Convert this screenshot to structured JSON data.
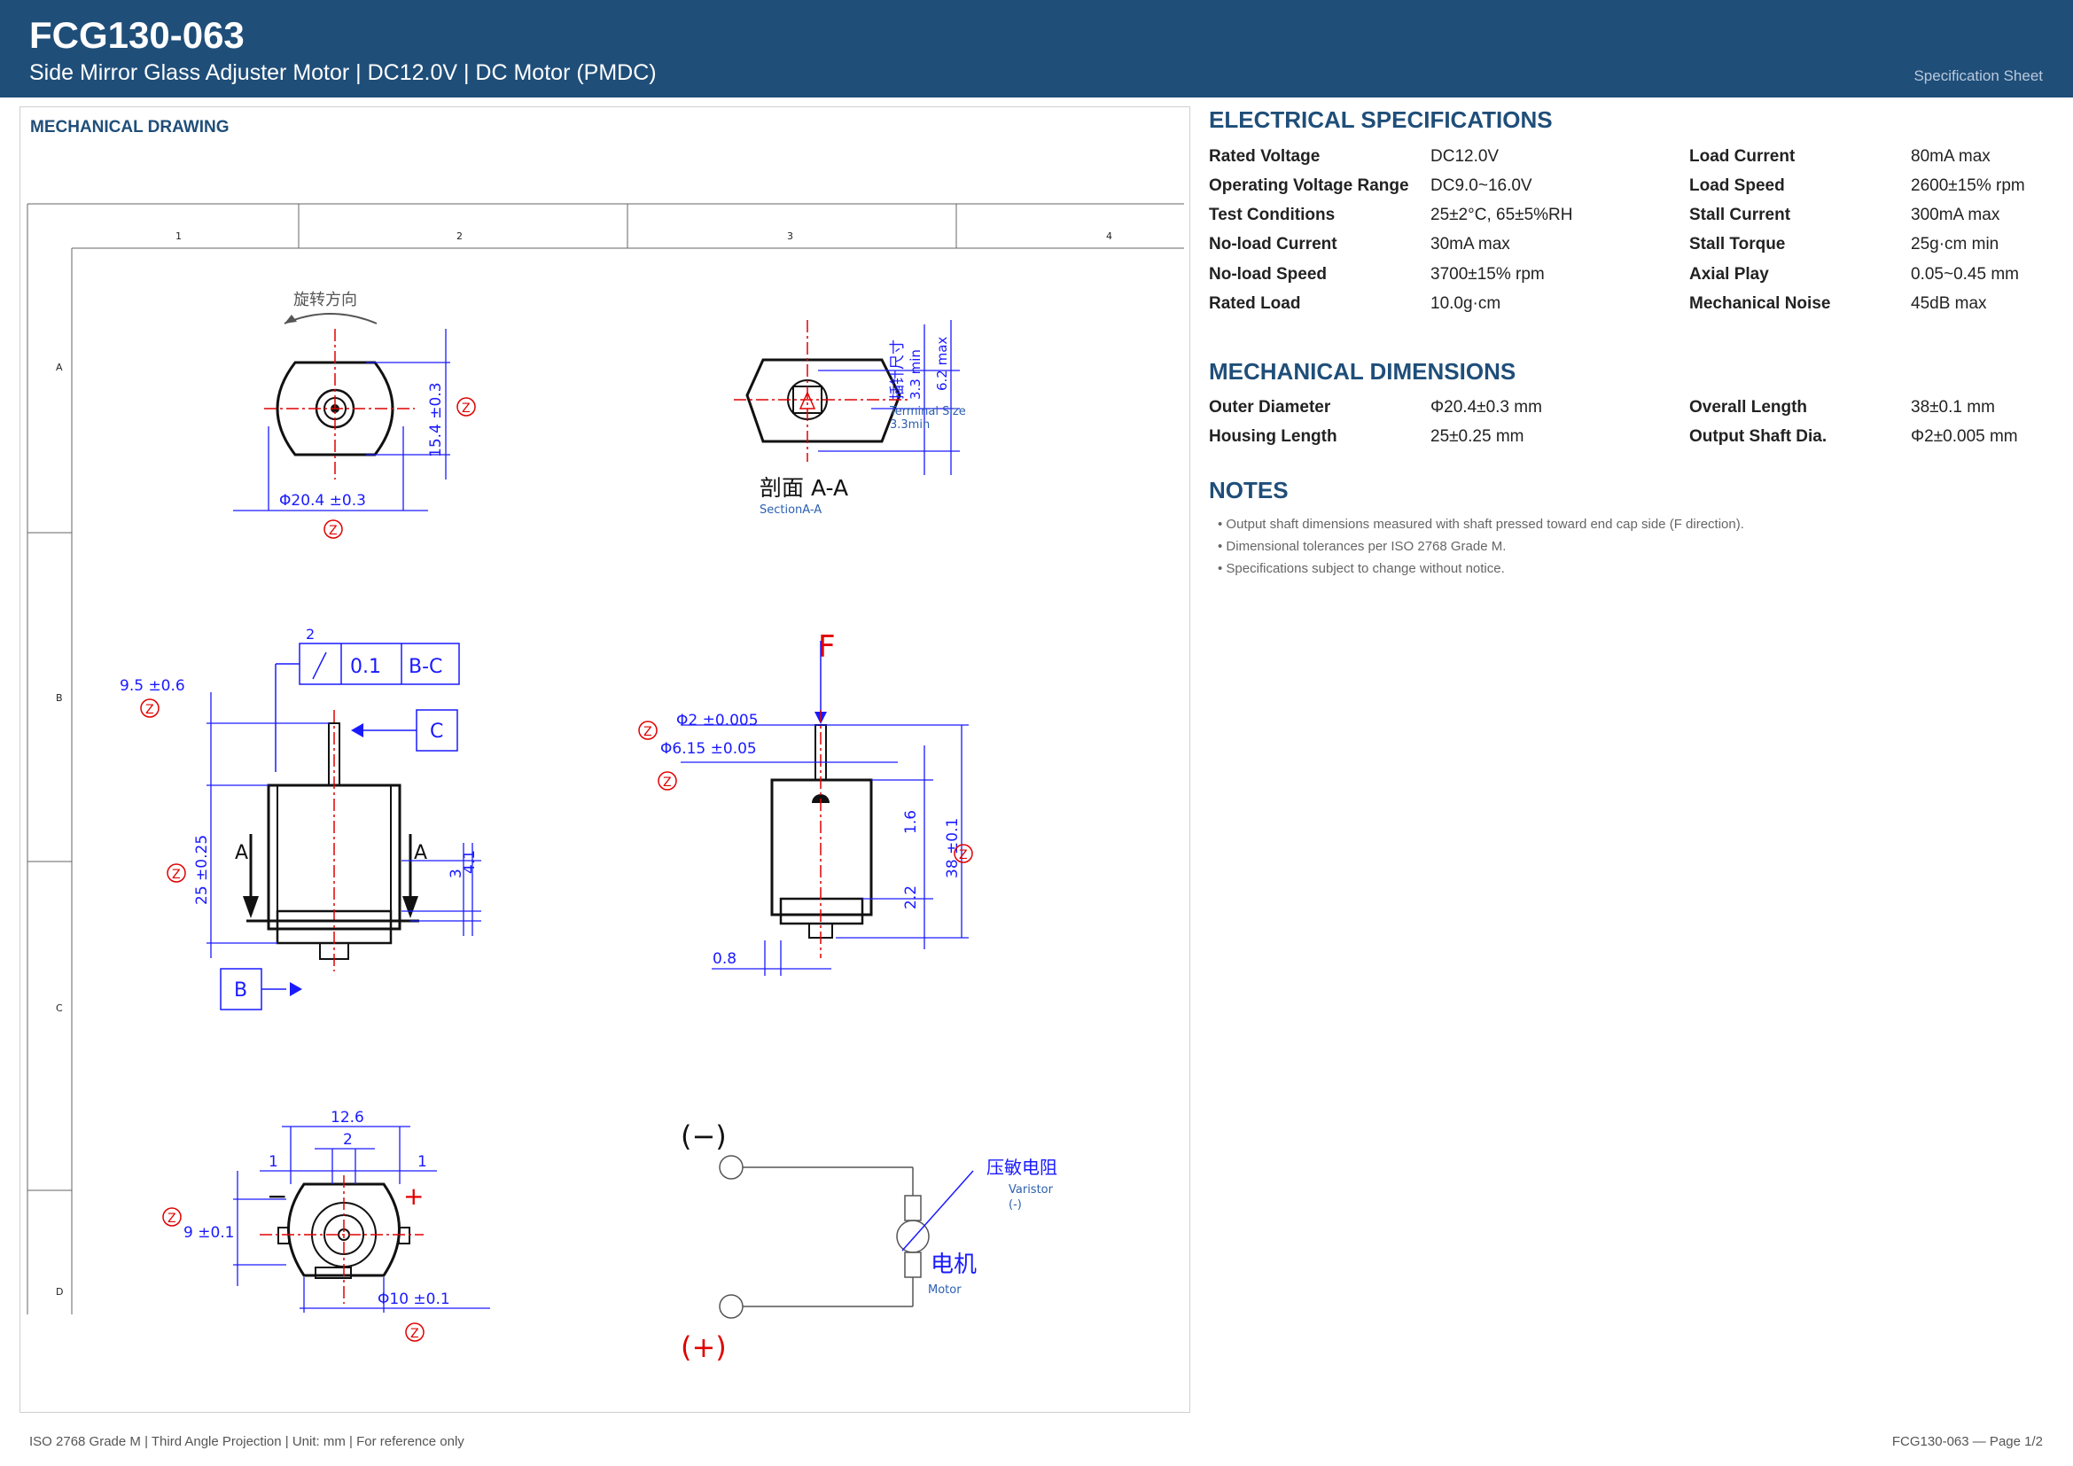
{
  "header": {
    "title": "FCG130-063",
    "subtitle": "Side Mirror Glass Adjuster Motor  |  DC12.0V  |  DC Motor (PMDC)",
    "sheet_label": "Specification Sheet"
  },
  "drawing": {
    "panel_label": "MECHANICAL DRAWING",
    "grid_columns": [
      "1",
      "2",
      "3",
      "4"
    ],
    "grid_rows": [
      "A",
      "B",
      "C",
      "D"
    ],
    "annotations": {
      "rotation_cn": "旋转方向",
      "dia_20_4": "Φ20.4  ±0.3",
      "h_15_4": "15.4  ±0.3",
      "section_cn": "剖面  A-A",
      "section_en": "SectionA-A",
      "terminal_cn": "插针尺寸",
      "terminal_min": "3.3 min",
      "terminal_max": "6.2 max",
      "terminal_en": "Terminal Size",
      "terminal_en_min": "3.3min",
      "runout_num": "2",
      "runout_val": "0.1",
      "runout_ref": "B-C",
      "datum_c": "C",
      "datum_b": "B",
      "shaft_len": "9.5  ±0.6",
      "housing_len": "25  ±0.25",
      "dim_3": "3",
      "dim_4_1": "4.1",
      "section_mark": "A",
      "force_f": "F",
      "shaft_dia": "Φ2  ±0.005",
      "boss_dia": "Φ6.15  ±0.05",
      "dim_1_6": "1.6",
      "dim_2_2": "2.2",
      "overall_len": "38  ±0.1",
      "dim_0_8": "0.8",
      "dim_12_6": "12.6",
      "dim_2": "2",
      "dim_1": "1",
      "dim_9": "9  ±0.1",
      "dim_10": "Φ10  ±0.1",
      "minus": "−",
      "plus": "+",
      "circuit_neg": "(−)",
      "circuit_pos": "(+)",
      "varistor_cn": "压敏电阻",
      "varistor_en": "Varistor",
      "varistor_sub": "(-)",
      "motor_cn": "电机",
      "motor_en": "Motor",
      "z_mark": "Z"
    },
    "colors": {
      "dimension": "#1a1aff",
      "centerline": "#e00000",
      "outline": "#111111",
      "grid": "#666666"
    }
  },
  "electrical": {
    "title": "ELECTRICAL SPECIFICATIONS",
    "left": [
      {
        "label": "Rated Voltage",
        "value": "DC12.0V"
      },
      {
        "label": "Operating Voltage Range",
        "value": "DC9.0~16.0V"
      },
      {
        "label": "Test Conditions",
        "value": "25±2°C, 65±5%RH"
      },
      {
        "label": "No-load Current",
        "value": "30mA max"
      },
      {
        "label": "No-load Speed",
        "value": "3700±15% rpm"
      },
      {
        "label": "Rated Load",
        "value": "10.0g·cm"
      }
    ],
    "right": [
      {
        "label": "Load Current",
        "value": "80mA max"
      },
      {
        "label": "Load Speed",
        "value": "2600±15% rpm"
      },
      {
        "label": "Stall Current",
        "value": "300mA max"
      },
      {
        "label": "Stall Torque",
        "value": "25g·cm min"
      },
      {
        "label": "Axial Play",
        "value": "0.05~0.45 mm"
      },
      {
        "label": "Mechanical Noise",
        "value": "45dB max"
      }
    ]
  },
  "mechanical": {
    "title": "MECHANICAL DIMENSIONS",
    "left": [
      {
        "label": "Outer Diameter",
        "value": "Φ20.4±0.3 mm"
      },
      {
        "label": "Housing Length",
        "value": "25±0.25 mm"
      }
    ],
    "right": [
      {
        "label": "Overall Length",
        "value": "38±0.1 mm"
      },
      {
        "label": "Output Shaft Dia.",
        "value": "Φ2±0.005 mm"
      }
    ]
  },
  "notes": {
    "title": "NOTES",
    "items": [
      "• Output shaft dimensions measured with shaft pressed toward end cap side (F direction).",
      "• Dimensional tolerances per ISO 2768 Grade M.",
      "• Specifications subject to change without notice."
    ]
  },
  "footer": {
    "left": "ISO 2768 Grade M  |  Third Angle Projection  |  Unit: mm  |  For reference only",
    "right": "FCG130-063  —  Page 1/2"
  }
}
